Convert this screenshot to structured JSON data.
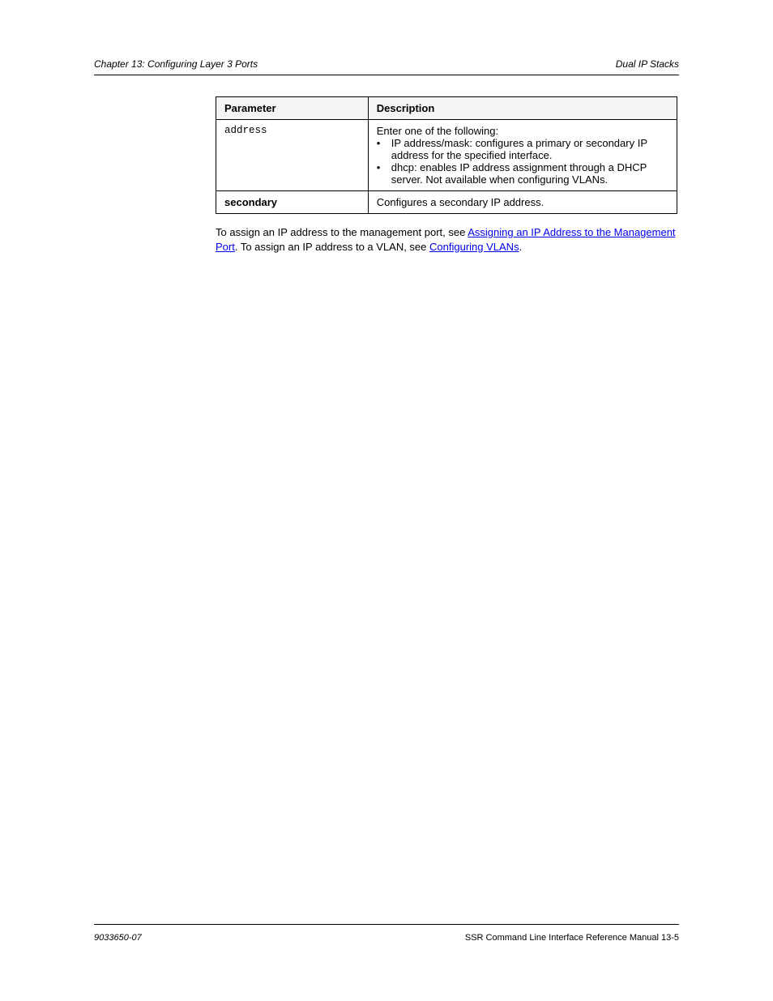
{
  "header": {
    "left": "Chapter 13: Configuring Layer 3 Ports",
    "right": "Dual IP Stacks"
  },
  "table": {
    "caption": "",
    "headers": {
      "param": "Parameter",
      "desc": "Description"
    },
    "rows": [
      {
        "param": "address",
        "desc_intro": "Enter one of the following:",
        "bullets": [
          "IP address/mask: configures a primary or secondary IP address for the specified interface.",
          "dhcp: enables IP address assignment through a DHCP server. Not available when configuring VLANs."
        ]
      },
      {
        "param": "secondary",
        "desc": "Configures a secondary IP address."
      }
    ]
  },
  "note": {
    "prefix": "To assign an IP address to the management port, see ",
    "link1": "Assigning an IP Address to the Management Port",
    "suffix": ". To assign an IP address to a VLAN, see ",
    "link2": "Configuring VLANs",
    "tail": "."
  },
  "footer": {
    "left": "9033650-07",
    "right": "SSR Command Line Interface Reference Manual   13-5"
  }
}
